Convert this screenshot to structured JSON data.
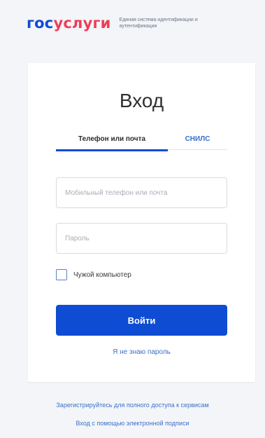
{
  "header": {
    "logo_part1": "гос",
    "logo_part2": "услуги",
    "tagline": "Единая система идентификации и аутентификации"
  },
  "login": {
    "title": "Вход",
    "tabs": [
      {
        "label": "Телефон или почта",
        "active": true
      },
      {
        "label": "СНИЛС",
        "active": false
      }
    ],
    "login_placeholder": "Мобильный телефон или почта",
    "password_placeholder": "Пароль",
    "checkbox_label": "Чужой компьютер",
    "submit_label": "Войти",
    "forgot_label": "Я не знаю пароль"
  },
  "footer": {
    "register_link": "Зарегистрируйтесь для полного доступа к сервисам",
    "esign_link": "Вход с помощью электронной подписи"
  },
  "colors": {
    "brand_blue": "#0d4cd3",
    "brand_red": "#ee3f58",
    "link_blue": "#3b6fcb",
    "background": "#f3f5f8"
  }
}
